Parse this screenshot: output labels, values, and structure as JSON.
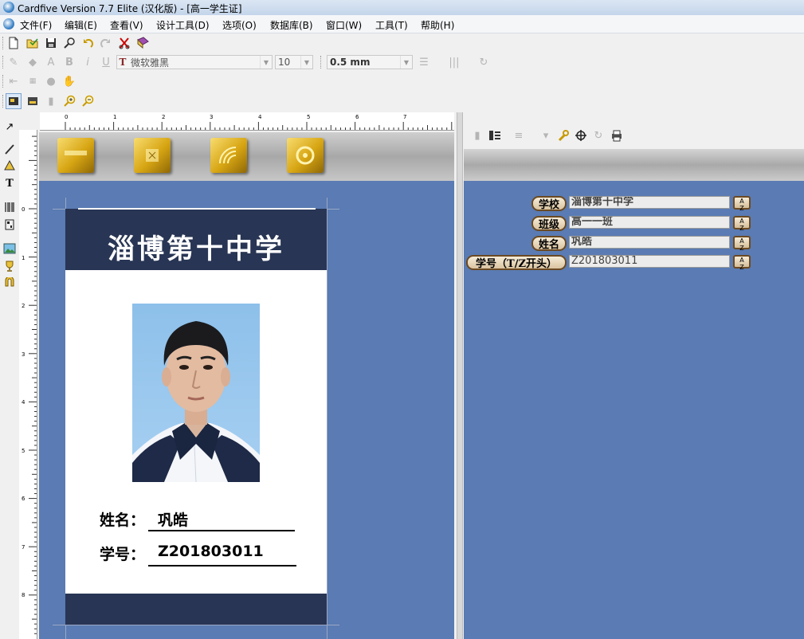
{
  "window": {
    "title": "Cardfive Version 7.7 Elite (汉化版) - [高一学生证]"
  },
  "menu": [
    {
      "label": "文件(F)"
    },
    {
      "label": "编辑(E)"
    },
    {
      "label": "查看(V)"
    },
    {
      "label": "设计工具(D)"
    },
    {
      "label": "选项(O)"
    },
    {
      "label": "数据库(B)"
    },
    {
      "label": "窗口(W)"
    },
    {
      "label": "工具(T)"
    },
    {
      "label": "帮助(H)"
    }
  ],
  "format_toolbar": {
    "font_name": "微软雅黑",
    "font_size": "10",
    "line_width": "0.5 mm",
    "font_icon_glyph": "T"
  },
  "ruler": {
    "horizontal": [
      "0",
      "1",
      "2",
      "3",
      "4",
      "5",
      "6",
      "7"
    ],
    "vertical": [
      "0",
      "1",
      "2",
      "3",
      "4",
      "5",
      "6",
      "7",
      "8"
    ]
  },
  "card": {
    "school": "淄博第十中学",
    "name_label": "姓名：",
    "name_value": "巩皓",
    "id_label": "学号：",
    "id_value": "Z201803011"
  },
  "database_form": {
    "fields": [
      {
        "label": "学校",
        "value": "淄博第十中学"
      },
      {
        "label": "班级",
        "value": "高一一班"
      },
      {
        "label": "姓名",
        "value": "巩皓"
      },
      {
        "label": "学号（T/Z开头）",
        "value": "Z201803011"
      }
    ],
    "sort_icon_text": "A\nZ"
  },
  "colors": {
    "canvas_bg": "#5a7bb3",
    "card_band": "#283554",
    "gold": "#d7a513",
    "label_border": "#6b4a23"
  }
}
